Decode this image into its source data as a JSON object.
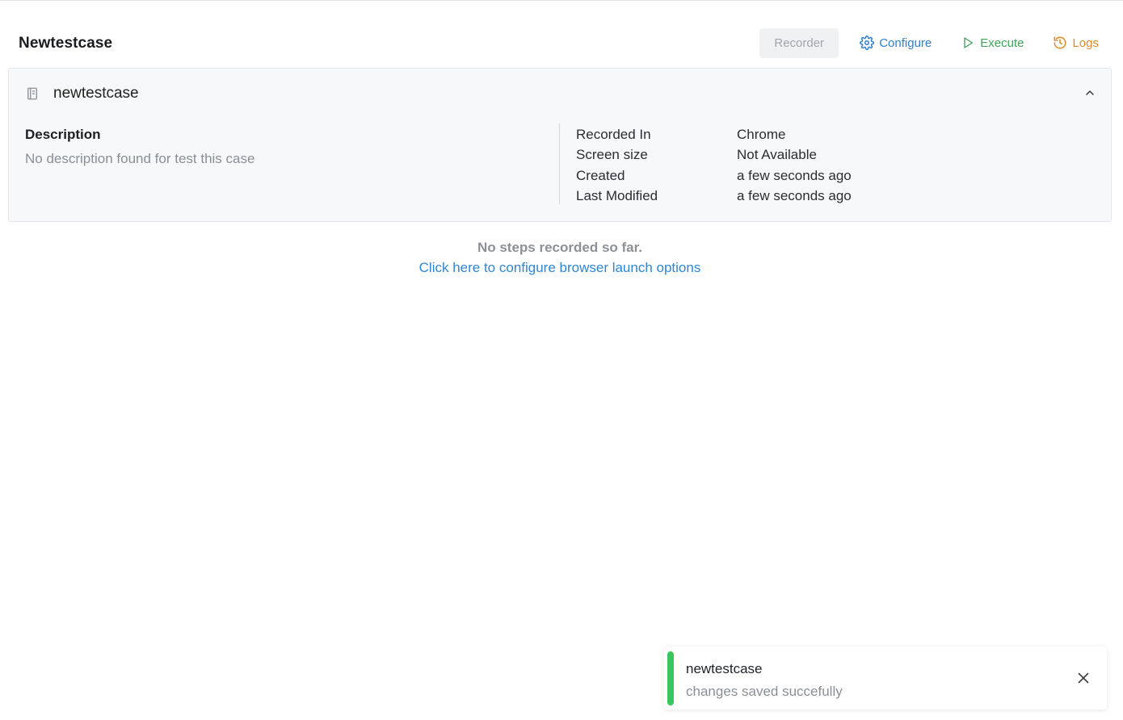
{
  "header": {
    "title": "Newtestcase",
    "toolbar": {
      "recorder_label": "Recorder",
      "configure_label": "Configure",
      "execute_label": "Execute",
      "logs_label": "Logs"
    }
  },
  "card": {
    "name": "newtestcase",
    "description_label": "Description",
    "description_text": "No description found for test this case",
    "meta": [
      {
        "key": "Recorded In",
        "value": "Chrome"
      },
      {
        "key": "Screen size",
        "value": "Not Available"
      },
      {
        "key": "Created",
        "value": "a few seconds ago"
      },
      {
        "key": "Last Modified",
        "value": "a few seconds ago"
      }
    ]
  },
  "empty_state": {
    "message": "No steps recorded so far.",
    "link": "Click here to configure browser launch options"
  },
  "toast": {
    "title": "newtestcase",
    "message": "changes saved succefully",
    "status_color": "#3cc55b"
  },
  "icons": {
    "configure": "gear-icon",
    "execute": "play-icon",
    "logs": "history-icon",
    "card": "document-icon",
    "collapse": "chevron-up-icon",
    "toast_close": "close-icon"
  },
  "colors": {
    "configure": "#2f7fcf",
    "execute": "#3fa35a",
    "logs": "#e08a2a",
    "link": "#2e86d4"
  }
}
